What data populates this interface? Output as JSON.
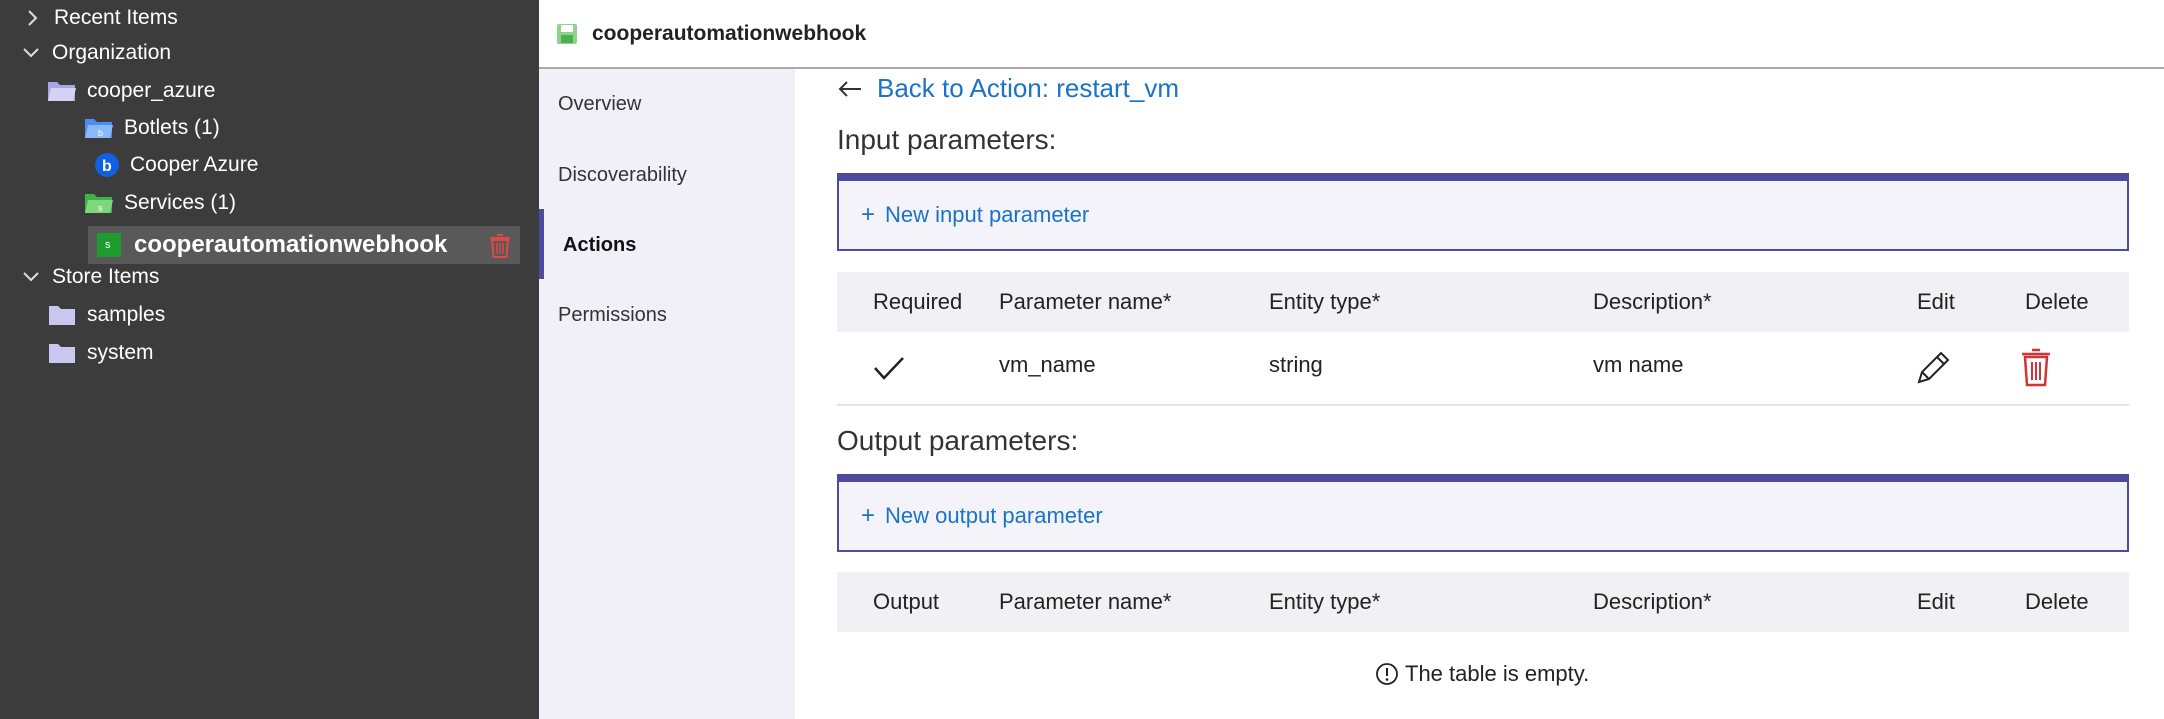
{
  "tree": {
    "recent_items": "Recent Items",
    "organization": "Organization",
    "cooper_azure": "cooper_azure",
    "botlets": "Botlets (1)",
    "cooper_azure_bot": "Cooper Azure",
    "services": "Services (1)",
    "selected_service": "cooperautomationwebhook",
    "store_items": "Store Items",
    "samples": "samples",
    "system": "system"
  },
  "header": {
    "title": "cooperautomationwebhook"
  },
  "nav": [
    "Overview",
    "Discoverability",
    "Actions",
    "Permissions"
  ],
  "content": {
    "back_label": "Back to Action: restart_vm",
    "input_title": "Input parameters:",
    "new_input": "New input parameter",
    "input_headers": [
      "Required",
      "Parameter name",
      "Entity type",
      "Description",
      "Edit",
      "Delete"
    ],
    "input_rows": [
      {
        "name": "vm_name",
        "type": "string",
        "description": "vm name"
      }
    ],
    "output_title": "Output parameters:",
    "new_output": "New output parameter",
    "output_headers": [
      "Output",
      "Parameter name",
      "Entity type",
      "Description",
      "Edit",
      "Delete"
    ],
    "empty_text": "The table is empty."
  },
  "colors": {
    "accent": "#4d4b9c",
    "link": "#1a73c7",
    "delete": "#d13438",
    "tree_bg": "#3c3c3c"
  }
}
